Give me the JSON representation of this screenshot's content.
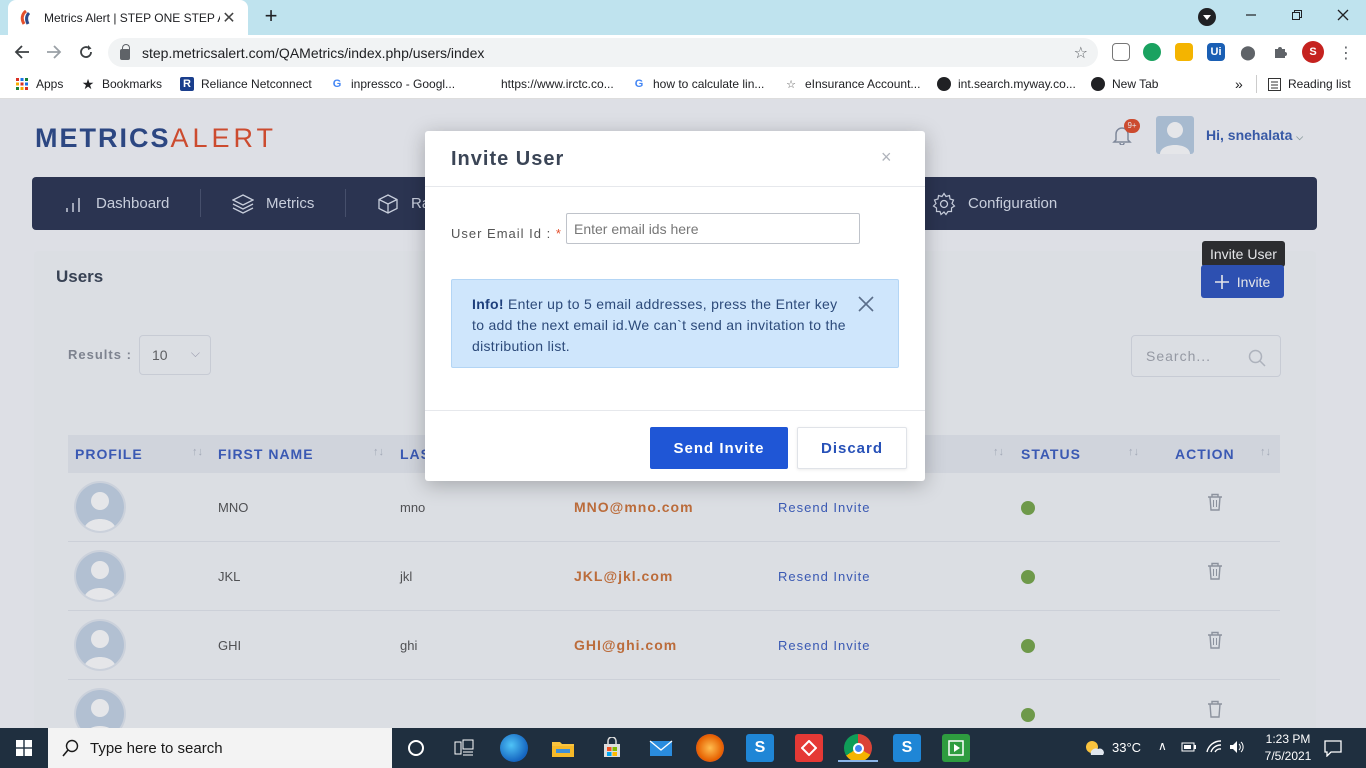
{
  "browser": {
    "tab_title": "Metrics Alert | STEP ONE STEP AHEAD",
    "tab_close": "✕",
    "new_tab": "+",
    "url": "step.metricsalert.com/QAMetrics/index.php/users/index",
    "profile_initial": "S",
    "bookmarks": [
      {
        "label": "Apps"
      },
      {
        "label": "Bookmarks"
      },
      {
        "label": "Reliance Netconnect"
      },
      {
        "label": "inpressco - Googl..."
      },
      {
        "label": "https://www.irctc.co..."
      },
      {
        "label": "how to calculate lin..."
      },
      {
        "label": "eInsurance Account..."
      },
      {
        "label": "int.search.myway.co..."
      },
      {
        "label": "New Tab"
      }
    ],
    "more": "»",
    "reading_list": "Reading list",
    "colors": {
      "tabbar": "#bfe3ee",
      "profile": "#c5221f"
    }
  },
  "app": {
    "logo_part1": "METRICS",
    "logo_part2": "ALERT",
    "notification_badge": "9+",
    "greeting": "Hi, snehalata",
    "nav": [
      {
        "label": "Dashboard",
        "icon": "bar-chart-icon"
      },
      {
        "label": "Metrics",
        "icon": "layers-icon"
      },
      {
        "label": "Ra",
        "icon": "cube-icon"
      },
      {
        "label": "Configuration",
        "icon": "gear-icon"
      }
    ],
    "users_title": "Users",
    "tooltip": "Invite User",
    "invite_label": "Invite",
    "results_label": "Results :",
    "results_value": "10",
    "search_placeholder": "Search...",
    "columns": [
      "PROFILE",
      "FIRST NAME",
      "LAS",
      "STATUS",
      "ACTION"
    ],
    "rows": [
      {
        "first": "MNO",
        "last": "mno",
        "email": "MNO@mno.com",
        "resend": "Resend Invite"
      },
      {
        "first": "JKL",
        "last": "jkl",
        "email": "JKL@jkl.com",
        "resend": "Resend Invite"
      },
      {
        "first": "GHI",
        "last": "ghi",
        "email": "GHI@ghi.com",
        "resend": "Resend Invite"
      }
    ],
    "colors": {
      "accent": "#2e55c0",
      "email": "#d0753a",
      "status_active": "#78a84a",
      "nav_bg": "#2c3553"
    }
  },
  "modal": {
    "title": "Invite User",
    "close": "×",
    "email_label": "User Email Id :",
    "required_mark": "*",
    "email_placeholder": "Enter email ids here",
    "info_bold": "Info!",
    "info_text": " Enter up to 5 email addresses, press the Enter key to add the next email id.We can`t send an invitation to the distribution list.",
    "send_label": "Send Invite",
    "discard_label": "Discard"
  },
  "taskbar": {
    "search_placeholder": "Type here to search",
    "temperature": "33°C",
    "time": "1:23 PM",
    "date": "7/5/2021"
  }
}
